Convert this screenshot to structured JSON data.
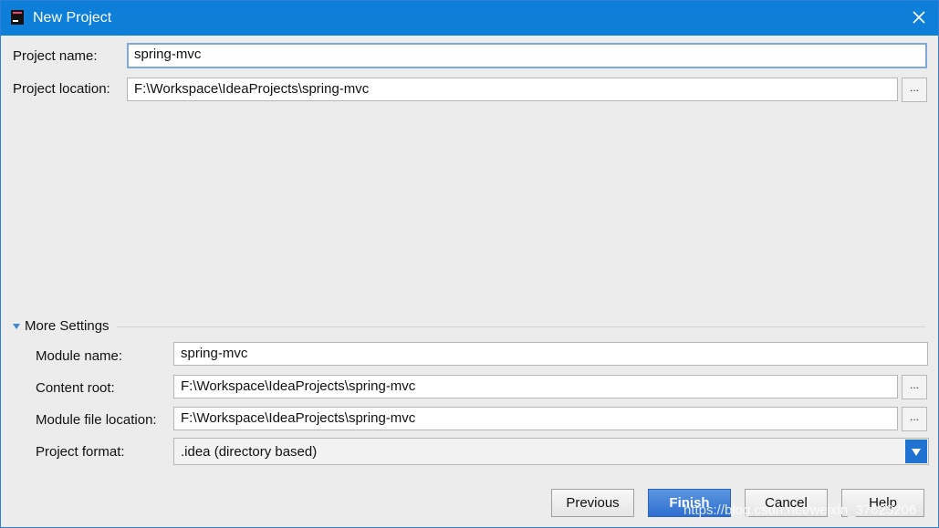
{
  "window": {
    "title": "New Project",
    "app_icon": "intellij-icon",
    "close_icon": "close-icon"
  },
  "fields": {
    "project_name": {
      "label": "Project name:",
      "value": "spring-mvc"
    },
    "project_location": {
      "label": "Project location:",
      "value": "F:\\Workspace\\IdeaProjects\\spring-mvc",
      "browse": "..."
    }
  },
  "more_settings": {
    "label": "More Settings",
    "module_name": {
      "label": "Module name:",
      "value": "spring-mvc"
    },
    "content_root": {
      "label": "Content root:",
      "value": "F:\\Workspace\\IdeaProjects\\spring-mvc",
      "browse": "..."
    },
    "module_file_location": {
      "label": "Module file location:",
      "value": "F:\\Workspace\\IdeaProjects\\spring-mvc",
      "browse": "..."
    },
    "project_format": {
      "label": "Project format:",
      "value": ".idea (directory based)"
    }
  },
  "buttons": {
    "previous": "Previous",
    "finish": "Finish",
    "cancel": "Cancel",
    "help": "Help"
  },
  "watermark": "https://blog.csdn.net/weixin_37623206"
}
